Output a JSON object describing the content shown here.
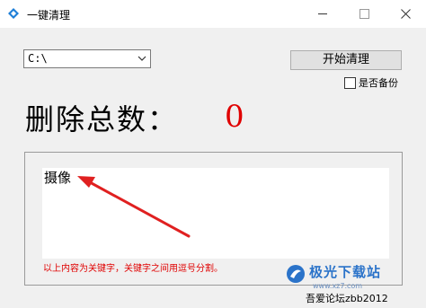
{
  "window": {
    "title": "一键清理",
    "icon": "app-diamond-icon"
  },
  "toolbar": {
    "drive_value": "C:\\",
    "start_button": "开始清理",
    "backup_label": "是否备份",
    "backup_checked": false
  },
  "total": {
    "label": "删除总数：",
    "count": "0",
    "count_color": "#e00000"
  },
  "keywords": {
    "value": "摄像",
    "hint": "以上内容为关键字，关键字之间用逗号分割。"
  },
  "footer": {
    "credit": "吾爱论坛zbb2012"
  },
  "watermark": {
    "brand": "极光下载站",
    "url": "www.xz7.com"
  },
  "annotation": {
    "arrow_color": "#e02020"
  }
}
